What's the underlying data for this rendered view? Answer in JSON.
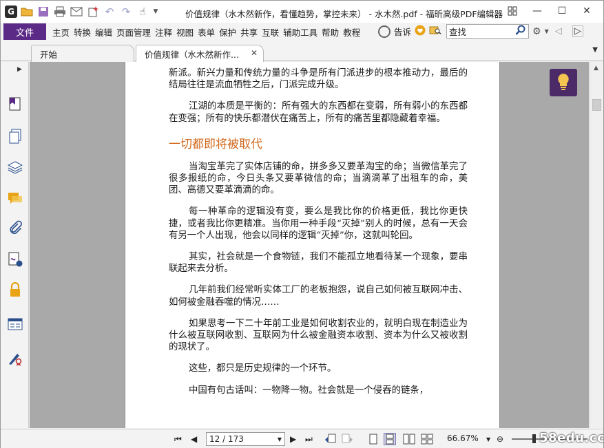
{
  "window": {
    "title": "价值规律（水木然新作，看懂趋势，掌控未来） - 水木然.pdf - 福昕高级PDF编辑器"
  },
  "quick_access": {
    "icons": [
      "app-logo-icon",
      "open-folder-icon",
      "save-icon",
      "print-icon",
      "email-icon",
      "new-icon",
      "undo-icon",
      "redo-icon",
      "hand-tool-icon"
    ]
  },
  "menubar": {
    "file_label": "文件",
    "items": [
      "主页",
      "转换",
      "编辑",
      "页面管理",
      "注释",
      "视图",
      "表单",
      "保护",
      "共享",
      "互联",
      "辅助工具",
      "帮助",
      "教程"
    ],
    "tell_me": "告诉",
    "search_placeholder": "查找"
  },
  "tabs": [
    {
      "label": "开始"
    },
    {
      "label": "价值规律（水木然新作..."
    }
  ],
  "document": {
    "paragraphs_top": [
      {
        "text": "新派。新兴力量和传统力量的斗争是所有门派进步的根本推动力，最后的结局往往是流血牺牲之后，门派完成升级。",
        "indent": false
      },
      {
        "text": "江湖的本质是平衡的：所有强大的东西都在变弱，所有弱小的东西都在变强；所有的快乐都潜伏在痛苦上，所有的痛苦里都隐藏着幸福。",
        "indent": true
      }
    ],
    "heading": "一切都即将被取代",
    "paragraphs_bottom": [
      {
        "text": "当淘宝革完了实体店铺的命，拼多多又要革淘宝的命；当微信革完了很多报纸的命，今日头条又要革微信的命；当滴滴革了出租车的命，美团、高德又要革滴滴的命。"
      },
      {
        "text": "每一种革命的逻辑没有变，要么是我比你的价格更低，我比你更快捷，或者我比你更精准。当你用一种手段“灭掉”别人的时候，总有一天会有另一个人出现，他会以同样的逻辑“灭掉”你，这就叫轮回。"
      },
      {
        "text": "其实，社会就是一个食物链，我们不能孤立地看待某一个现象，要串联起来去分析。"
      },
      {
        "text": "几年前我们经常听实体工厂的老板抱怨，说自己如何被互联网冲击、如何被金融吞噬的情况……"
      },
      {
        "text": "如果思考一下二十年前工业是如何收割农业的，就明白现在制造业为什么被互联网收割、互联网为什么被金融资本收割、资本为什么又被收割的现状了。"
      },
      {
        "text": "这些，都只是历史规律的一个环节。"
      },
      {
        "text": "中国有句古话叫：一物降一物。社会就是一个侵吞的链条，"
      }
    ]
  },
  "statusbar": {
    "page_value": "12 / 173",
    "zoom": "66.67%",
    "watermark": "58edu.cc"
  },
  "colors": {
    "accent_purple": "#5b2a86",
    "heading_orange": "#d2691e",
    "doc_background": "#a9a9a9"
  }
}
